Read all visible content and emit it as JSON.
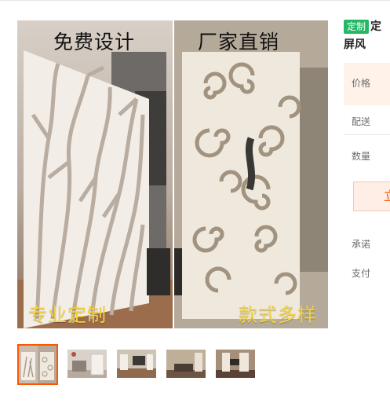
{
  "gallery": {
    "banner_left": "免费设计",
    "banner_right": "厂家直销",
    "caption_left": "专业定制",
    "caption_right": "款式多样",
    "thumbnail_count": 5,
    "active_thumbnail": 1
  },
  "product": {
    "tag": "定制",
    "title_line1": "定",
    "title_line2": "屏风"
  },
  "details": {
    "price_label": "价格",
    "shipping_label": "配送",
    "quantity_label": "数量",
    "buy_button": "立",
    "promise_label": "承诺",
    "payment_label": "支付"
  },
  "colors": {
    "tag": "#25b864",
    "accent": "#ff5500",
    "price_bg": "#fff2e8",
    "caption": "#f4d23a"
  }
}
